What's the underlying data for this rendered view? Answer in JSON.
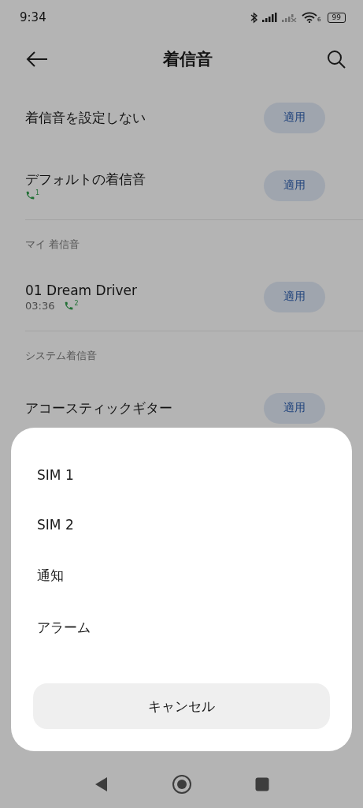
{
  "status_bar": {
    "time": "9:34",
    "wifi_badge": "6",
    "battery": "99"
  },
  "header": {
    "title": "着信音"
  },
  "sections": [
    {
      "rows": [
        {
          "title": "着信音を設定しない",
          "action": "適用"
        },
        {
          "title": "デフォルトの着信音",
          "sim": "1",
          "action": "適用"
        }
      ]
    },
    {
      "heading": "マイ 着信音",
      "rows": [
        {
          "title": "01 Dream Driver",
          "duration": "03:36",
          "sim": "2",
          "action": "適用"
        }
      ]
    },
    {
      "heading": "システム着信音",
      "rows": [
        {
          "title": "アコースティックギター",
          "action": "適用"
        }
      ]
    }
  ],
  "sheet": {
    "options": [
      "SIM 1",
      "SIM 2",
      "通知",
      "アラーム"
    ],
    "cancel": "キャンセル"
  }
}
